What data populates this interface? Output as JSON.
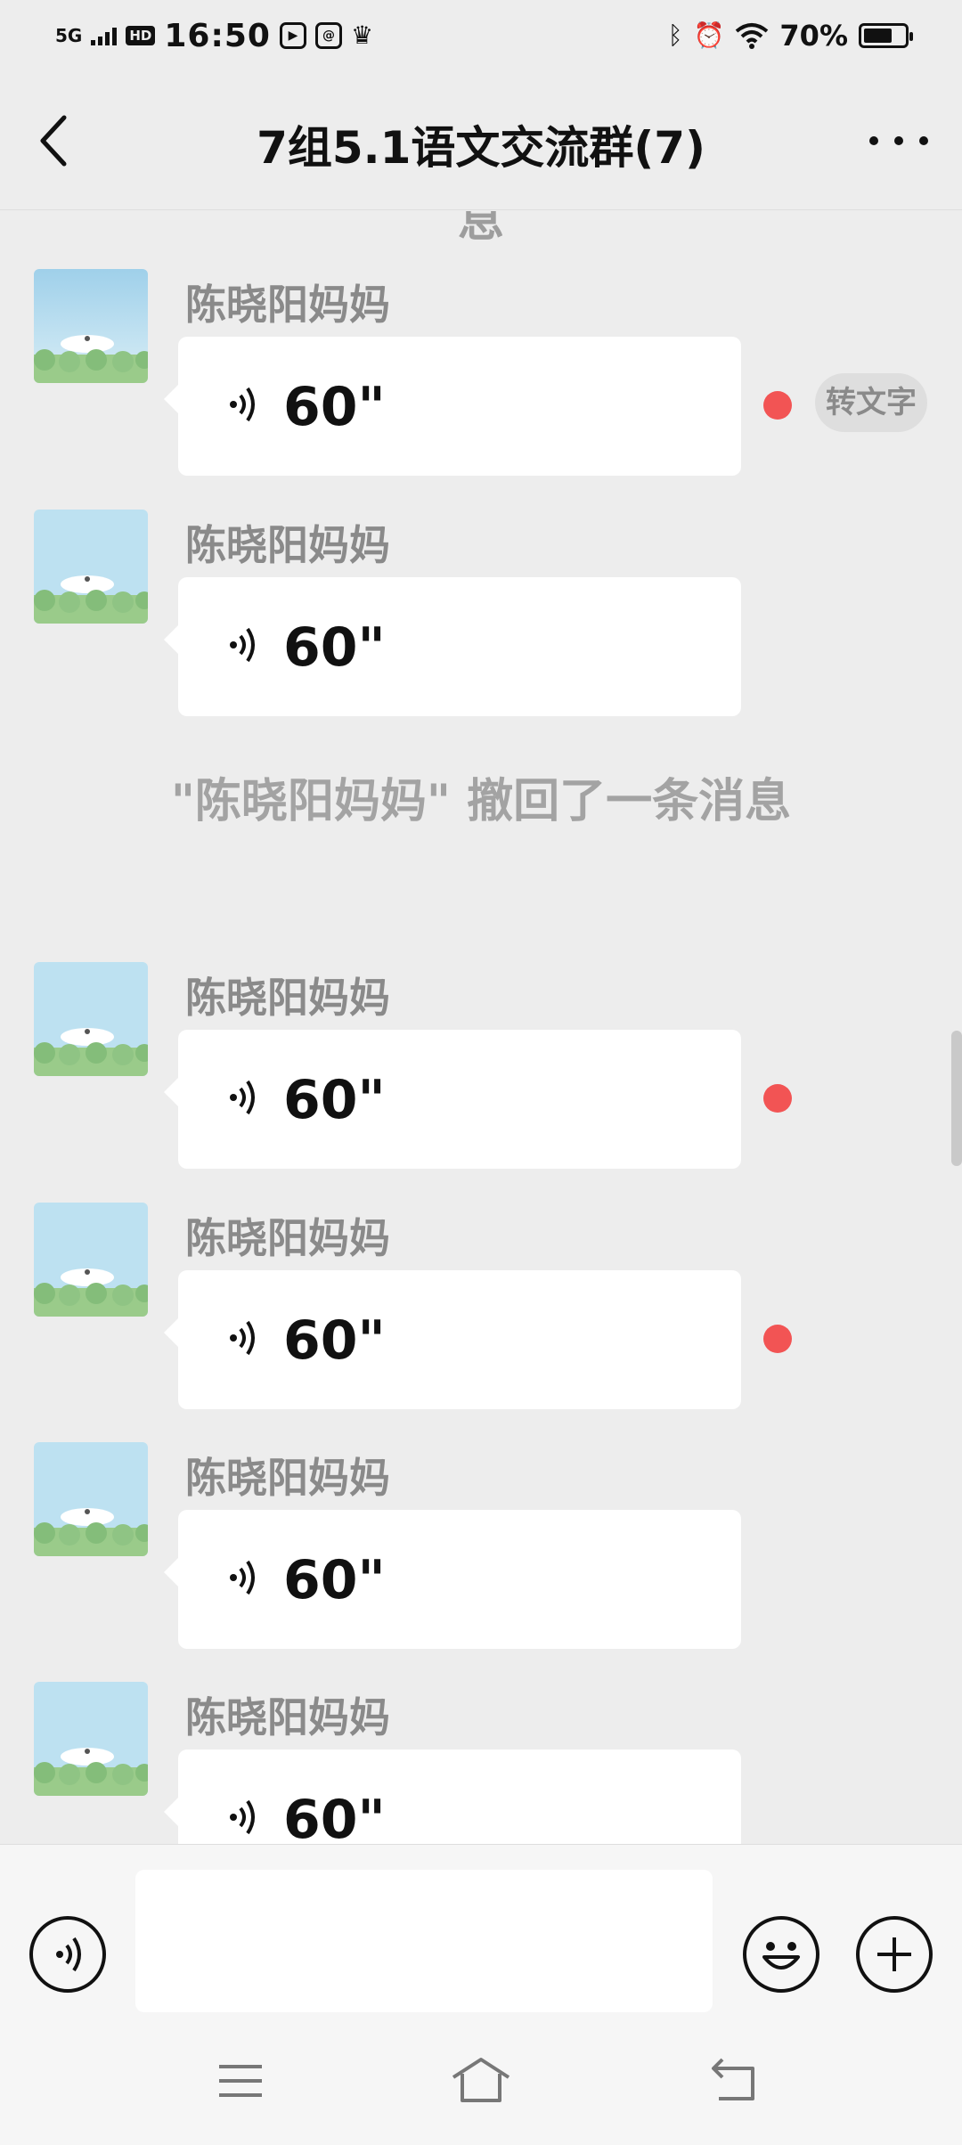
{
  "status_bar": {
    "network": "5G",
    "hd_badge": "HD",
    "time": "16:50",
    "battery": "70%",
    "battery_level": 0.7
  },
  "header": {
    "title": "7组5.1语文交流群(7)"
  },
  "chat": {
    "partial_top_text": "息",
    "messages": [
      {
        "sender": "陈晓阳妈妈",
        "duration": "60\"",
        "unread": true,
        "to_text_label": "转文字"
      },
      {
        "sender": "陈晓阳妈妈",
        "duration": "60\"",
        "unread": false
      }
    ],
    "recall_notice": "\"陈晓阳妈妈\" 撤回了一条消息",
    "messages_after": [
      {
        "sender": "陈晓阳妈妈",
        "duration": "60\"",
        "unread": true
      },
      {
        "sender": "陈晓阳妈妈",
        "duration": "60\"",
        "unread": true
      },
      {
        "sender": "陈晓阳妈妈",
        "duration": "60\"",
        "unread": false
      },
      {
        "sender": "陈晓阳妈妈",
        "duration": "60\"",
        "unread": false
      }
    ]
  },
  "input_bar": {
    "value": "",
    "icons": [
      "voice-input-icon",
      "emoji-icon",
      "plus-icon"
    ]
  },
  "system_nav": {
    "icons": [
      "menu-icon",
      "home-icon",
      "back-icon"
    ]
  },
  "colors": {
    "background": "#ededed",
    "bubble": "#ffffff",
    "unread_dot": "#f25454",
    "sender_text": "#8a8a8a"
  }
}
